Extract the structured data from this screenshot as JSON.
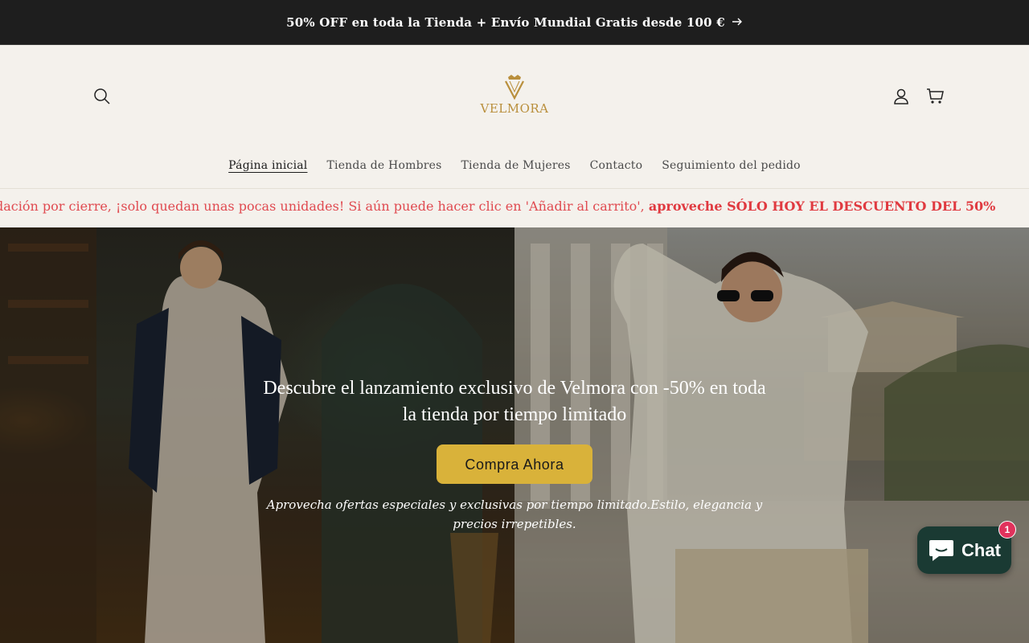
{
  "announcement": {
    "text": "50% OFF en toda la Tienda + Envío Mundial Gratis desde 100 €",
    "arrow_icon": "arrow-right-icon"
  },
  "header": {
    "logo_text": "VELMORA",
    "icons": {
      "search": "search-icon",
      "account": "user-icon",
      "cart": "cart-icon"
    },
    "brand_color": "#b98f3c"
  },
  "nav": {
    "items": [
      {
        "label": "Página inicial",
        "active": true
      },
      {
        "label": "Tienda de Hombres",
        "active": false
      },
      {
        "label": "Tienda de Mujeres",
        "active": false
      },
      {
        "label": "Contacto",
        "active": false
      },
      {
        "label": "Seguimiento del pedido",
        "active": false
      }
    ]
  },
  "marquee": {
    "text": "dación por cierre, ¡solo quedan unas pocas unidades! Si aún puede hacer clic en 'Añadir al carrito', ",
    "bold_text": "aproveche SÓLO HOY EL DESCUENTO DEL 50%",
    "color": "#e04a50"
  },
  "hero": {
    "title": "Descubre el lanzamiento exclusivo de Velmora con -50% en toda la tienda por tiempo limitado",
    "cta_label": "Compra Ahora",
    "subtitle": "Aprovecha ofertas especiales y exclusivas por tiempo limitado.Estilo, elegancia y precios irrepetibles.",
    "cta_color": "#d9b23a"
  },
  "chat": {
    "label": "Chat",
    "badge_count": "1",
    "icon": "chat-bubble-icon",
    "color": "#1a3a33"
  }
}
